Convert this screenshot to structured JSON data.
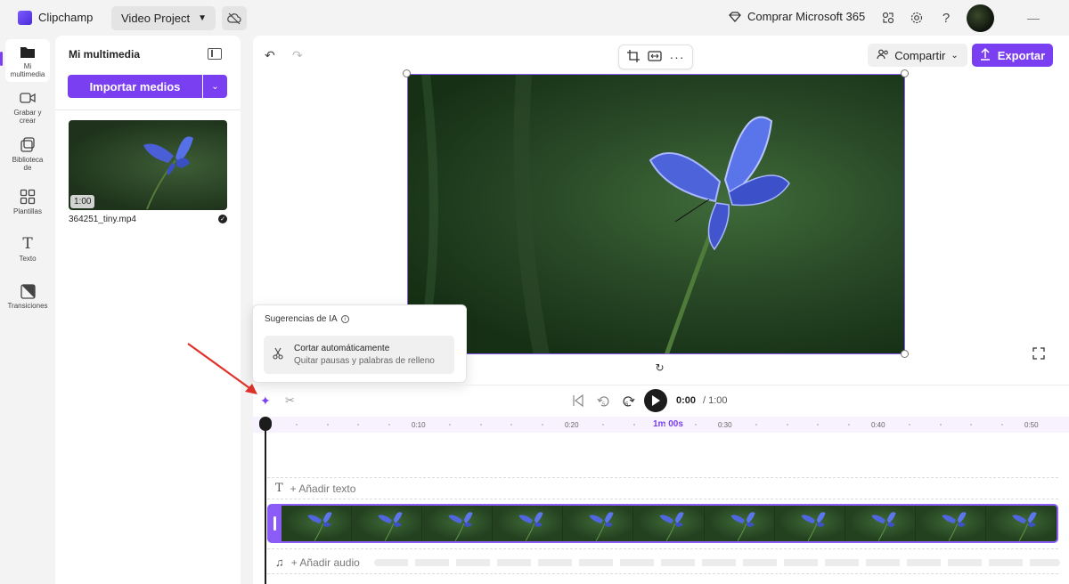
{
  "app": {
    "name": "Clipchamp",
    "project": "Video Project"
  },
  "titlebar": {
    "buy": "Comprar Microsoft 365"
  },
  "rail": {
    "items": [
      {
        "label": "Mi multimedia"
      },
      {
        "label": "Grabar y crear"
      },
      {
        "label": "Biblioteca de"
      },
      {
        "label": "Plantillas"
      },
      {
        "label": "Texto"
      },
      {
        "label": "Transiciones"
      }
    ]
  },
  "media": {
    "title": "Mi multimedia",
    "import_label": "Importar medios",
    "file": {
      "name": "364251_tiny.mp4",
      "duration": "1:00"
    }
  },
  "editor": {
    "share_label": "Compartir",
    "export_label": "Exportar"
  },
  "ai": {
    "title": "Sugerencias de IA",
    "item_title": "Cortar automáticamente",
    "item_sub": "Quitar pausas y palabras de relleno"
  },
  "playback": {
    "current": "0:00",
    "total": "/ 1:00",
    "skip_label": "5"
  },
  "ruler": {
    "labels": [
      "0:10",
      "0:20",
      "0:30",
      "0:40",
      "0:50"
    ],
    "highlight": "1m 00s"
  },
  "tracks": {
    "add_text": "+ Añadir texto",
    "add_audio": "+ Añadir audio"
  },
  "colors": {
    "accent": "#7b3ff2",
    "selection": "#8b5cf6"
  }
}
